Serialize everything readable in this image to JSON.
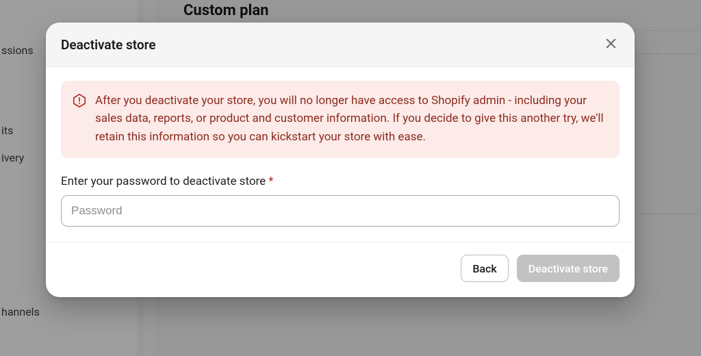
{
  "background": {
    "heading": "Custom plan",
    "sidebar_items": [
      "ssions",
      "its",
      "ivery",
      "hannels"
    ]
  },
  "modal": {
    "title": "Deactivate store",
    "close_label": "Close",
    "alert_text": "After you deactivate your store, you will no longer have access to Shopify admin - including your sales data, reports, or product and customer information. If you decide to give this another try, we'll retain this information so you can kickstart your store with ease.",
    "password_label": "Enter your password to deactivate store",
    "password_required_marker": "*",
    "password_placeholder": "Password",
    "password_value": "",
    "back_label": "Back",
    "deactivate_label": "Deactivate store",
    "deactivate_enabled": false
  }
}
